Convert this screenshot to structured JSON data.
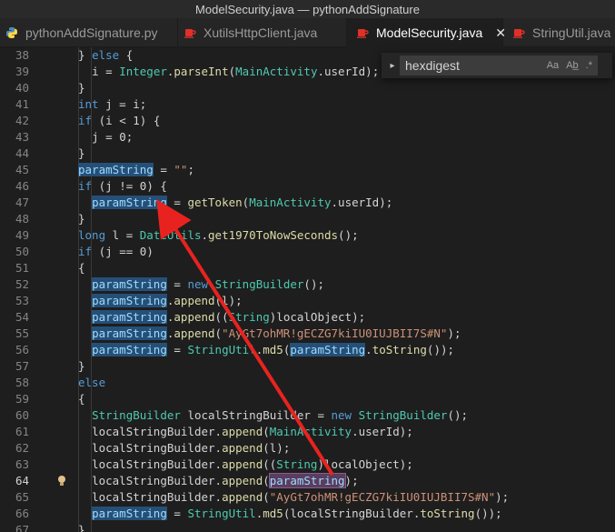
{
  "window": {
    "title": "ModelSecurity.java — pythonAddSignature"
  },
  "tabs": [
    {
      "label": "pythonAddSignature.py",
      "icon": "python-icon",
      "active": false
    },
    {
      "label": "XutilsHttpClient.java",
      "icon": "java-cup-icon",
      "active": false
    },
    {
      "label": "ModelSecurity.java",
      "icon": "java-cup-icon",
      "active": true,
      "close": "✕"
    },
    {
      "label": "StringUtil.java",
      "icon": "java-cup-icon",
      "active": false
    }
  ],
  "find": {
    "toggle": "▸",
    "query": "hexdigest",
    "match_case": "Aa",
    "whole_word": "Ab̲",
    "regex": ".*"
  },
  "colors": {
    "highlight": "#264f78",
    "arrow": "#e8231f",
    "keyword": "#569cd6",
    "type": "#4ec9b0",
    "string": "#ce9178"
  },
  "editor": {
    "current_line": "64",
    "lines": [
      {
        "n": "38",
        "code": "  } else {"
      },
      {
        "n": "39",
        "code": "    i = Integer.parseInt(MainActivity.userId);"
      },
      {
        "n": "40",
        "code": "  }"
      },
      {
        "n": "41",
        "code": "  int j = i;"
      },
      {
        "n": "42",
        "code": "  if (i < 1) {"
      },
      {
        "n": "43",
        "code": "    j = 0;"
      },
      {
        "n": "44",
        "code": "  }"
      },
      {
        "n": "45",
        "code": "  paramString = \"\";"
      },
      {
        "n": "46",
        "code": "  if (j != 0) {"
      },
      {
        "n": "47",
        "code": "    paramString = getToken(MainActivity.userId);"
      },
      {
        "n": "48",
        "code": "  }"
      },
      {
        "n": "49",
        "code": "  long l = DateUtils.get1970ToNowSeconds();"
      },
      {
        "n": "50",
        "code": "  if (j == 0)"
      },
      {
        "n": "51",
        "code": "  {"
      },
      {
        "n": "52",
        "code": "    paramString = new StringBuilder();"
      },
      {
        "n": "53",
        "code": "    paramString.append(l);"
      },
      {
        "n": "54",
        "code": "    paramString.append((String)localObject);"
      },
      {
        "n": "55",
        "code": "    paramString.append(\"AyGt7ohMR!gECZG7kiIU0IUJBII7S#N\");"
      },
      {
        "n": "56",
        "code": "    paramString = StringUtil.md5(paramString.toString());"
      },
      {
        "n": "57",
        "code": "  }"
      },
      {
        "n": "58",
        "code": "  else"
      },
      {
        "n": "59",
        "code": "  {"
      },
      {
        "n": "60",
        "code": "    StringBuilder localStringBuilder = new StringBuilder();"
      },
      {
        "n": "61",
        "code": "    localStringBuilder.append(MainActivity.userId);"
      },
      {
        "n": "62",
        "code": "    localStringBuilder.append(l);"
      },
      {
        "n": "63",
        "code": "    localStringBuilder.append((String)localObject);"
      },
      {
        "n": "64",
        "code": "    localStringBuilder.append(paramString);"
      },
      {
        "n": "65",
        "code": "    localStringBuilder.append(\"AyGt7ohMR!gECZG7kiIU0IUJBII7S#N\");"
      },
      {
        "n": "66",
        "code": "    paramString = StringUtil.md5(localStringBuilder.toString());"
      },
      {
        "n": "67",
        "code": "  }"
      }
    ]
  }
}
